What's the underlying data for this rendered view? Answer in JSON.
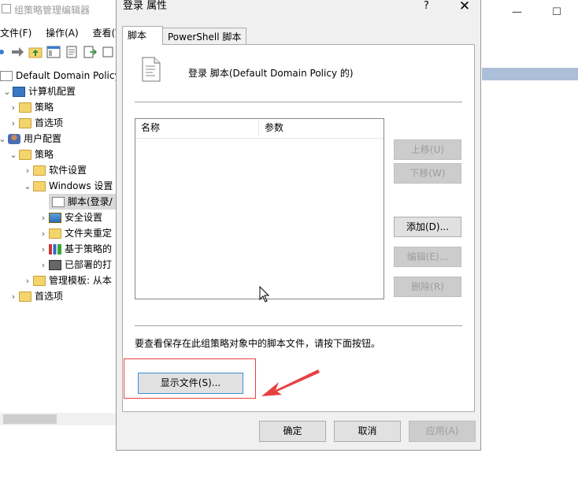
{
  "editor": {
    "title": "组策略管理编辑器",
    "menu": [
      "文件(F)",
      "操作(A)",
      "查看(V)"
    ],
    "minimize_glyph": "—",
    "maximize_glyph": "☐",
    "tree": [
      {
        "label": "Default Domain Policy [",
        "indent": 0,
        "arrow": "",
        "icon": "script-icon"
      },
      {
        "label": "计算机配置",
        "indent": 1,
        "arrow": "v",
        "icon": "computer-icon"
      },
      {
        "label": "策略",
        "indent": 2,
        "arrow": ">",
        "icon": "folder-icon"
      },
      {
        "label": "首选项",
        "indent": 2,
        "arrow": ">",
        "icon": "folder-icon"
      },
      {
        "label": "用户配置",
        "indent": 1,
        "arrow": "v",
        "icon": "user-icon"
      },
      {
        "label": "策略",
        "indent": 2,
        "arrow": "v",
        "icon": "folder-icon"
      },
      {
        "label": "软件设置",
        "indent": 3,
        "arrow": ">",
        "icon": "folder-icon"
      },
      {
        "label": "Windows 设置",
        "indent": 3,
        "arrow": "v",
        "icon": "folder-icon"
      },
      {
        "label": "脚本(登录/",
        "indent": 4,
        "arrow": "",
        "icon": "script-icon",
        "selected": true
      },
      {
        "label": "安全设置",
        "indent": 4,
        "arrow": ">",
        "icon": "shield-icon"
      },
      {
        "label": "文件夹重定",
        "indent": 4,
        "arrow": ">",
        "icon": "folder-icon"
      },
      {
        "label": "基于策略的",
        "indent": 4,
        "arrow": ">",
        "icon": "chart-icon"
      },
      {
        "label": "已部署的打",
        "indent": 4,
        "arrow": ">",
        "icon": "printer-icon"
      },
      {
        "label": "管理模板: 从本",
        "indent": 3,
        "arrow": ">",
        "icon": "folder-icon"
      },
      {
        "label": "首选项",
        "indent": 2,
        "arrow": ">",
        "icon": "folder-icon"
      }
    ]
  },
  "dialog": {
    "title": "登录 属性",
    "help": "?",
    "close": "✕",
    "tabs": [
      "脚本",
      "PowerShell 脚本"
    ],
    "heading": "登录 脚本(Default Domain Policy 的)",
    "columns": [
      "名称",
      "参数"
    ],
    "side_buttons": {
      "up": "上移(U)",
      "down": "下移(W)",
      "add": "添加(D)...",
      "edit": "编辑(E)...",
      "remove": "删除(R)"
    },
    "hint": "要查看保存在此组策略对象中的脚本文件，请按下面按钮。",
    "show_files": "显示文件(S)...",
    "ok": "确定",
    "cancel": "取消",
    "apply": "应用(A)"
  },
  "colors": {
    "highlight_box": "#e84040",
    "focus_border": "#3c8fd8"
  }
}
